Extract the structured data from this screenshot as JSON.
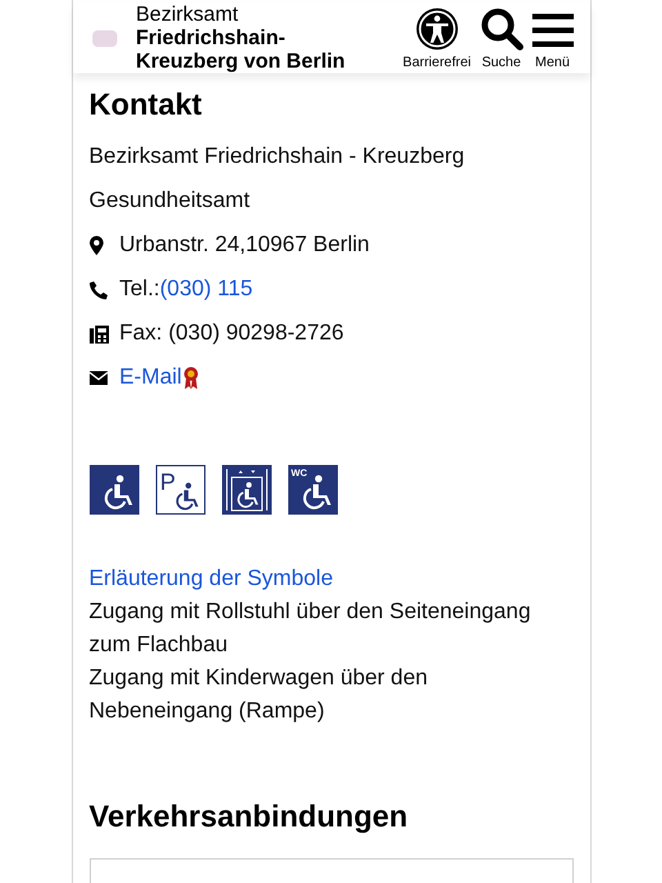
{
  "header": {
    "title_line1": "Bezirksamt",
    "title_line2": "Friedrichshain-Kreuzberg von Berlin",
    "actions": [
      {
        "kind": "accessibility",
        "label": "Barrierefrei"
      },
      {
        "kind": "search",
        "label": "Suche"
      },
      {
        "kind": "menu",
        "label": "Menü"
      }
    ]
  },
  "contact": {
    "heading": "Kontakt",
    "lines": [
      "Bezirksamt Friedrichshain - Kreuzberg",
      "Gesundheitsamt"
    ],
    "items": [
      {
        "kind": "address",
        "text": "Urbanstr. 24,10967 Berlin"
      },
      {
        "kind": "phone",
        "text": "Tel.:",
        "link": "(030) 115"
      },
      {
        "kind": "fax",
        "text": "Fax: (030) 90298-2726"
      },
      {
        "kind": "email",
        "link": "E-Mail"
      }
    ]
  },
  "symbols": [
    {
      "kind": "wheelchair"
    },
    {
      "kind": "parking",
      "label": "P"
    },
    {
      "kind": "elevator"
    },
    {
      "kind": "toilet",
      "label": "WC"
    }
  ],
  "symbols_link": "Erläuterung der Symbole",
  "notes": [
    "Zugang mit Rollstuhl über den Seiteneingang zum Flachbau",
    "Zugang mit Kinderwagen über den Nebeneingang (Rampe)"
  ],
  "transport": {
    "heading": "Verkehrsanbindungen"
  }
}
